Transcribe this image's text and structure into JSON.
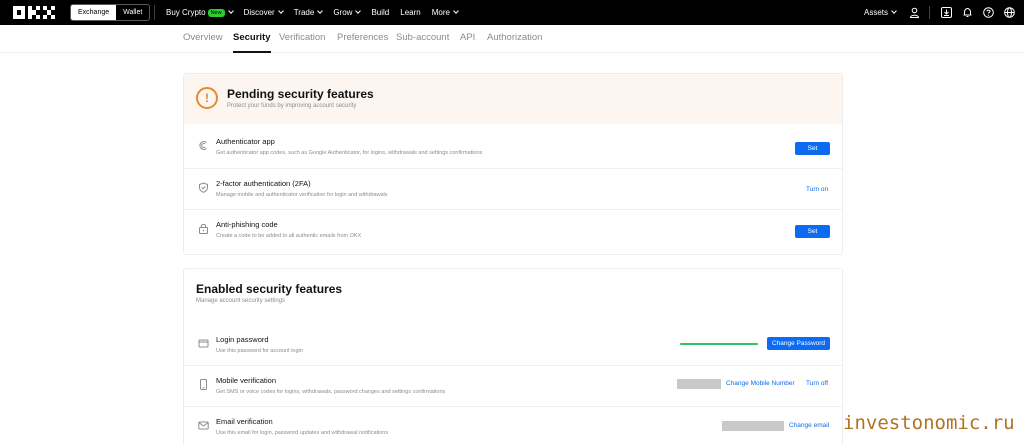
{
  "topnav": {
    "toggle": {
      "exchange": "Exchange",
      "wallet": "Wallet"
    },
    "links": [
      {
        "label": "Buy Crypto",
        "badge": "New",
        "dropdown": true
      },
      {
        "label": "Discover",
        "dropdown": true
      },
      {
        "label": "Trade",
        "dropdown": true
      },
      {
        "label": "Grow",
        "dropdown": true
      },
      {
        "label": "Build",
        "dropdown": false
      },
      {
        "label": "Learn",
        "dropdown": false
      },
      {
        "label": "More",
        "dropdown": true
      }
    ],
    "assets": "Assets",
    "icons": [
      "user-icon",
      "download-icon",
      "bell-icon",
      "help-icon",
      "globe-icon"
    ]
  },
  "subnav": {
    "tabs": [
      "Overview",
      "Security",
      "Verification",
      "Preferences",
      "Sub-account",
      "API",
      "Authorization"
    ],
    "active": "Security"
  },
  "pending": {
    "title": "Pending security features",
    "subtitle": "Protect your funds by improving account security",
    "items": [
      {
        "title": "Authenticator app",
        "desc": "Get authenticator app codes, such as Google Authenticator, for logins, withdrawals and settings confirmations",
        "action": "Set",
        "icon": "authenticator-icon"
      },
      {
        "title": "2-factor authentication (2FA)",
        "desc": "Manage mobile and authenticator verification for login and withdrawals",
        "action": "Turn on",
        "icon": "shield-icon"
      },
      {
        "title": "Anti-phishing code",
        "desc": "Create a code to be added to all authentic emails from OKX",
        "action": "Set",
        "icon": "lock-icon"
      }
    ]
  },
  "enabled": {
    "title": "Enabled security features",
    "subtitle": "Manage account security settings",
    "items": [
      {
        "title": "Login password",
        "desc": "Use this password for account login",
        "action": "Change Password",
        "icon": "password-icon"
      },
      {
        "title": "Mobile verification",
        "desc": "Get SMS or voice codes for logins, withdrawals, password changes and settings confirmations",
        "action": "Change Mobile Number",
        "action2": "Turn off",
        "icon": "phone-icon"
      },
      {
        "title": "Email verification",
        "desc": "Use this email for login, password updates and withdrawal notifications",
        "action": "Change email",
        "icon": "mail-icon"
      }
    ]
  },
  "watermark": "investonomic.ru",
  "colors": {
    "accent": "#0c6bf0",
    "warning": "#e58a2b",
    "success": "#2ec56a",
    "badge": "#2dcc31"
  }
}
